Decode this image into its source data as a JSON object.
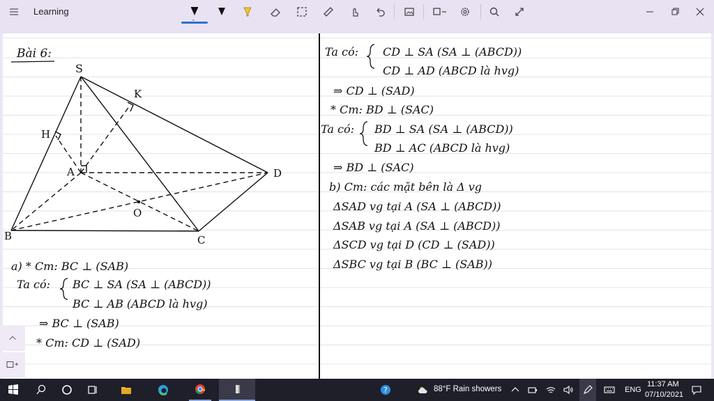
{
  "app": {
    "title": "Learning",
    "menu_icon": "hamburger-menu-icon"
  },
  "toolbar": {
    "tools": [
      {
        "name": "ballpoint-pen-black-icon",
        "selected": true
      },
      {
        "name": "pen-black-icon"
      },
      {
        "name": "highlighter-yellow-icon"
      },
      {
        "name": "eraser-icon"
      },
      {
        "name": "lasso-select-icon"
      },
      {
        "name": "ruler-icon"
      },
      {
        "name": "touch-writing-icon"
      },
      {
        "name": "undo-icon"
      },
      {
        "name": "insert-image-icon"
      },
      {
        "name": "shapes-icon"
      },
      {
        "name": "settings-icon"
      },
      {
        "name": "search-icon"
      },
      {
        "name": "fullscreen-icon"
      }
    ],
    "window": [
      "minimize-icon",
      "restore-icon",
      "close-icon"
    ]
  },
  "colors": {
    "titlebar": "#e8e2f2",
    "accent": "#2f6fd6",
    "taskbar": "#1f1f2a",
    "ink": "#111111",
    "highlighter": "#f4c430"
  },
  "notes": {
    "left": {
      "heading": "Bài 6:",
      "points": {
        "S": "S",
        "K": "K",
        "H": "H",
        "A": "A",
        "D": "D",
        "O": "O",
        "B": "B",
        "C": "C"
      },
      "part_a": {
        "l1": "a) * Cm: BC ⊥ (SAB)",
        "l2": "Ta có:",
        "l3": "BC ⊥ SA (SA ⊥ (ABCD))",
        "l4": "BC ⊥ AB (ABCD là hvg)",
        "l5": "⇒ BC ⊥ (SAB)",
        "l6": "* Cm: CD ⊥ (SAD)"
      }
    },
    "right": {
      "l1": "Ta có:",
      "l2": "CD ⊥ SA (SA ⊥ (ABCD))",
      "l3": "CD ⊥ AD (ABCD là hvg)",
      "l4": "⇒ CD ⊥ (SAD)",
      "l5": "* Cm: BD ⊥ (SAC)",
      "l6": "Ta có:",
      "l7": "BD ⊥ SA (SA ⊥ (ABCD))",
      "l8": "BD ⊥ AC (ABCD là hvg)",
      "l9": "⇒ BD ⊥ (SAC)",
      "l10": "b) Cm: các mặt bên là Δ vg",
      "l11": "ΔSAD vg tại A (SA ⊥ (ABCD))",
      "l12": "ΔSAB vg tại A (SA ⊥ (ABCD))",
      "l13": "ΔSCD vg tại D (CD ⊥ (SAD))",
      "l14": "ΔSBC vg tại B (BC ⊥ (SAB))"
    }
  },
  "taskbar": {
    "weather": "88°F  Rain showers",
    "lang": "ENG",
    "time": "11:37 AM",
    "date": "07/10/2021"
  }
}
